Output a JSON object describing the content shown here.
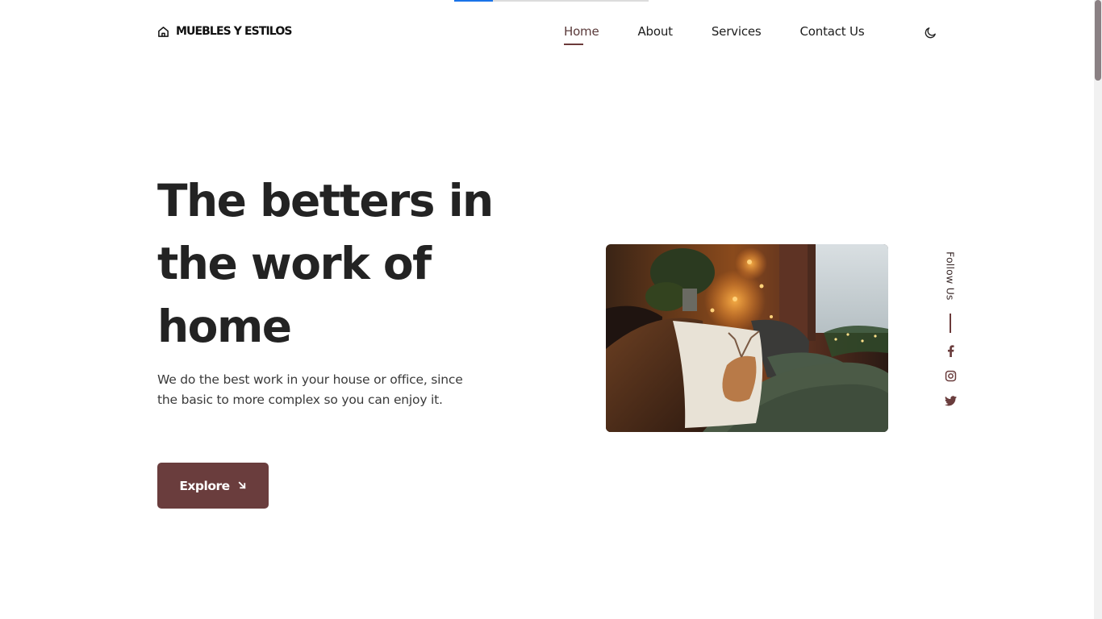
{
  "brand": {
    "name": "MUEBLES Y ESTILOS",
    "icon": "home-icon"
  },
  "nav": {
    "items": [
      {
        "label": "Home",
        "active": true
      },
      {
        "label": "About",
        "active": false
      },
      {
        "label": "Services",
        "active": false
      },
      {
        "label": "Contact Us",
        "active": false
      }
    ],
    "theme_toggle_icon": "moon-icon"
  },
  "hero": {
    "title": "The betters in the work of home",
    "description": "We do the best work in your house or office, since the basic to more complex so you can enjoy it.",
    "button_label": "Explore",
    "button_icon": "arrow-down-right-icon",
    "image_subject": "deer-pillow-cozy-bedroom-photo"
  },
  "social": {
    "label": "Follow Us",
    "items": [
      {
        "icon": "facebook-icon"
      },
      {
        "icon": "instagram-icon"
      },
      {
        "icon": "twitter-icon"
      }
    ]
  },
  "colors": {
    "accent": "#6a3d3d",
    "text": "#232323",
    "background": "#ffffff",
    "loading_bar": "#1a73e8"
  }
}
